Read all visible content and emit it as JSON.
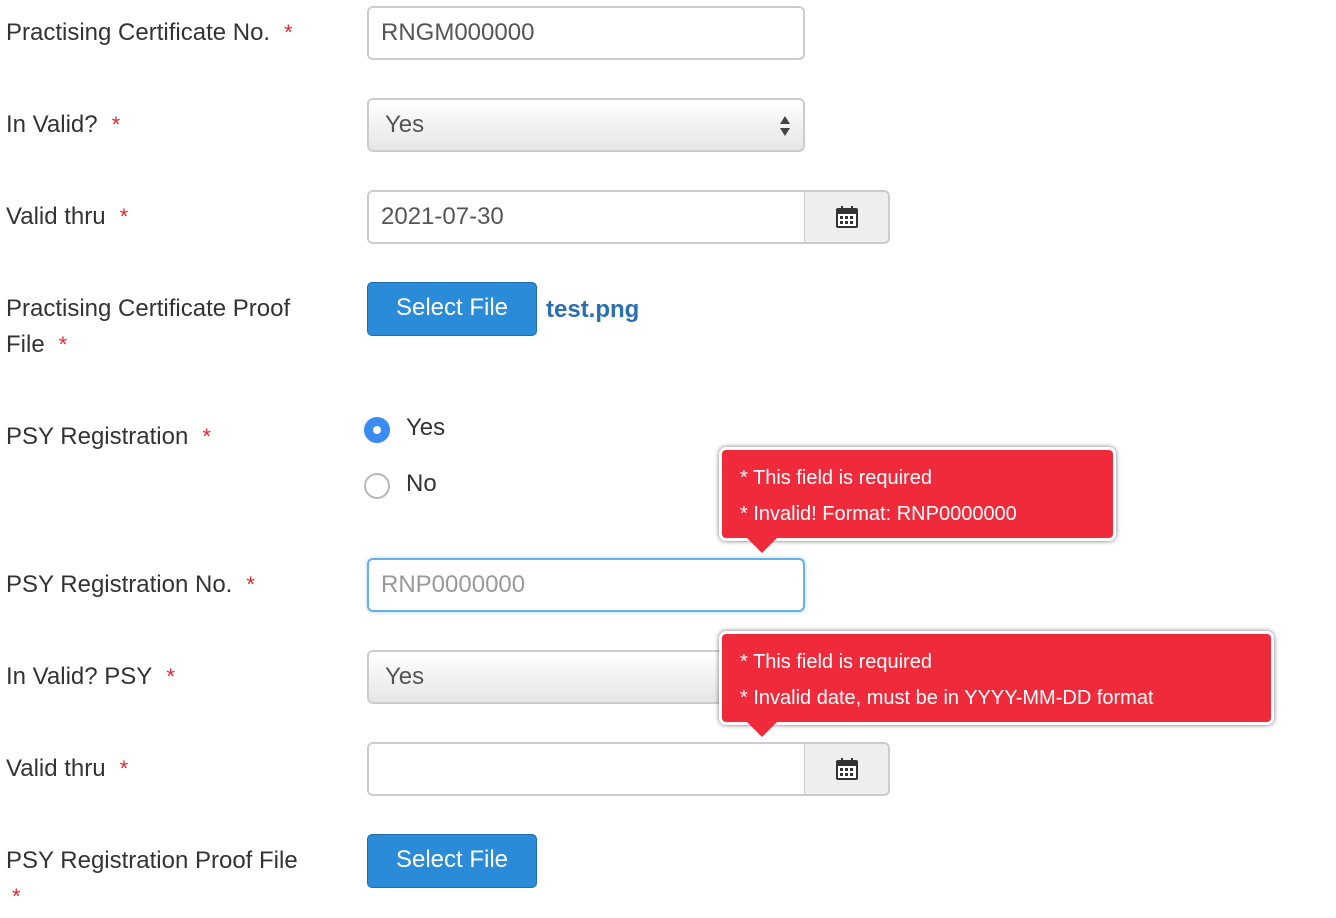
{
  "form": {
    "pc_no": {
      "label": "Practising Certificate No.",
      "required": "*",
      "value": "RNGM000000"
    },
    "in_valid": {
      "label": "In Valid?",
      "required": "*",
      "selected": "Yes"
    },
    "valid_thru": {
      "label": "Valid thru",
      "required": "*",
      "value": "2021-07-30"
    },
    "pc_proof": {
      "label_line1": "Practising Certificate Proof",
      "label_line2": "File",
      "required": "*",
      "button": "Select File",
      "filename": "test.png"
    },
    "psy_registration": {
      "label": "PSY Registration",
      "required": "*",
      "options": [
        {
          "label": "Yes",
          "checked": true
        },
        {
          "label": "No",
          "checked": false
        }
      ]
    },
    "psy_no": {
      "label": "PSY Registration No.",
      "required": "*",
      "placeholder": "RNP0000000",
      "value": ""
    },
    "in_valid_psy": {
      "label": "In Valid? PSY",
      "required": "*",
      "selected": "Yes"
    },
    "psy_valid_thru": {
      "label": "Valid thru",
      "required": "*",
      "value": ""
    },
    "psy_proof": {
      "label": "PSY Registration Proof File",
      "required": "*",
      "button": "Select File"
    }
  },
  "errors": {
    "psy_no": [
      "* This field is required",
      "* Invalid! Format: RNP0000000"
    ],
    "psy_valid_thru": [
      "* This field is required",
      "* Invalid date, must be in YYYY-MM-DD format"
    ]
  },
  "icons": {
    "calendar": "calendar-icon",
    "select_arrows": "updown-arrows-icon"
  },
  "colors": {
    "error": "#ef2b3b",
    "primary_button": "#2a8bd8",
    "radio_checked": "#3b8bf5",
    "required": "#e8262f",
    "filename": "#2a6fb0"
  }
}
